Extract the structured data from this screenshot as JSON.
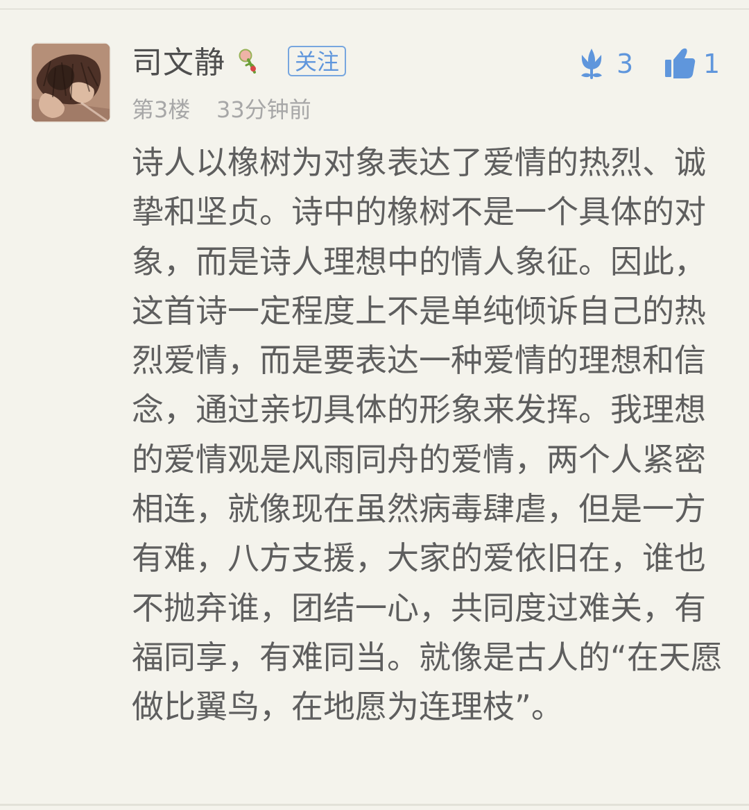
{
  "post": {
    "username": "司文静",
    "follow_label": "关注",
    "floor": "第3楼",
    "time_ago": "33分钟前",
    "flower_count": "3",
    "like_count": "1",
    "content": "诗人以橡树为对象表达了爱情的热烈、诚挚和坚贞。诗中的橡树不是一个具体的对象，而是诗人理想中的情人象征。因此，这首诗一定程度上不是单纯倾诉自己的热烈爱情，而是要表达一种爱情的理想和信念，通过亲切具体的形象来发挥。我理想的爱情观是风雨同舟的爱情，两个人紧密相连，就像现在虽然病毒肆虐，但是一方有难，八方支援，大家的爱依旧在，谁也不抛弃谁，团结一心，共同度过难关，有福同享，有难同当。就像是古人的“在天愿做比翼鸟，在地愿为连理枝”。"
  },
  "icons": {
    "avatar": "avatar",
    "badge": "badge-icon",
    "flower": "flower-icon",
    "like": "thumbs-up-icon"
  },
  "colors": {
    "background": "#f4f3ec",
    "text": "#5e5e5e",
    "meta": "#a7a7a7",
    "accent": "#5f96dc"
  }
}
